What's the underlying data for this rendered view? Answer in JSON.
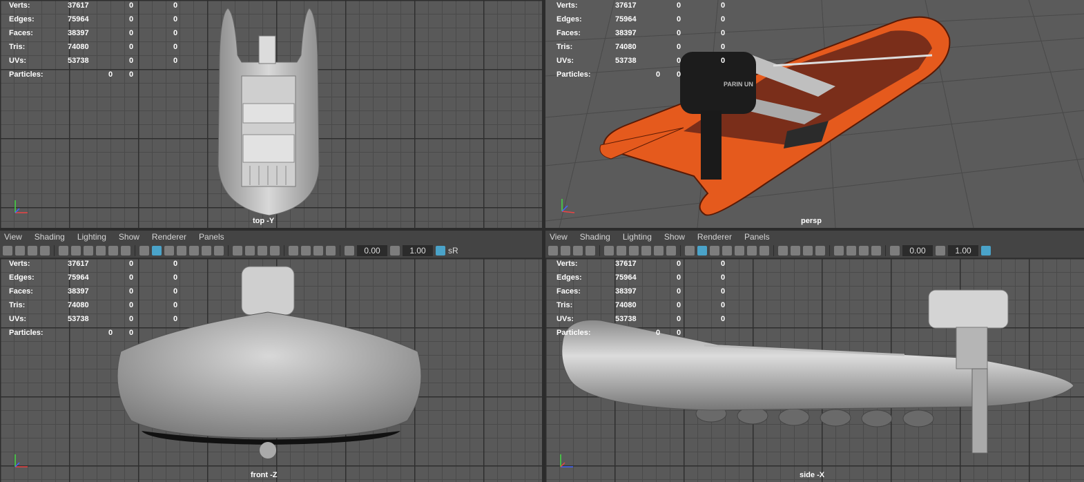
{
  "menu": [
    "View",
    "Shading",
    "Lighting",
    "Show",
    "Renderer",
    "Panels"
  ],
  "toolbar": {
    "value1": "0.00",
    "value2": "1.00",
    "sr_label": "sR"
  },
  "hud": {
    "rows": [
      {
        "label": "Verts:",
        "a": "37617",
        "b": "0",
        "c": "0"
      },
      {
        "label": "Edges:",
        "a": "75964",
        "b": "0",
        "c": "0"
      },
      {
        "label": "Faces:",
        "a": "38397",
        "b": "0",
        "c": "0"
      },
      {
        "label": "Tris:",
        "a": "74080",
        "b": "0",
        "c": "0"
      },
      {
        "label": "UVs:",
        "a": "53738",
        "b": "0",
        "c": "0"
      }
    ],
    "particles": {
      "label": "Particles:",
      "b": "0",
      "c": "0"
    }
  },
  "viewports": {
    "top": {
      "label": "top -Y"
    },
    "persp": {
      "label": "persp",
      "engine_text": "PARIN UN"
    },
    "front": {
      "label": "front -Z"
    },
    "side": {
      "label": "side -X"
    }
  },
  "colors": {
    "boat_orange": "#e55a1d",
    "boat_gray": "#b8b8b8",
    "viewport_bg": "#595959"
  }
}
